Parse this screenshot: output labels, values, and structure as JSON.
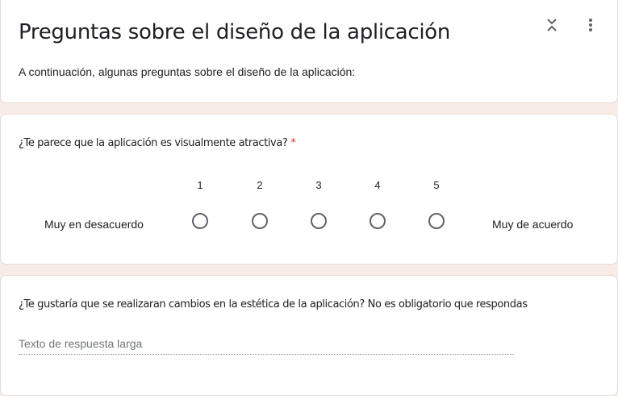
{
  "header": {
    "title": "Preguntas sobre el diseño de la aplicación",
    "description": "A continuación, algunas preguntas sobre el diseño de la aplicación:",
    "collapse_icon": "collapse-icon",
    "more_icon": "more-vert-icon"
  },
  "question1": {
    "title": "¿Te parece que la aplicación es visualmente atractiva?",
    "required_mark": "*",
    "scale": [
      "1",
      "2",
      "3",
      "4",
      "5"
    ],
    "low_label": "Muy en desacuerdo",
    "high_label": "Muy de acuerdo"
  },
  "question2": {
    "title": "¿Te gustaría que se realizaran cambios en la estética de la aplicación? No es obligatorio que respondas",
    "placeholder": "Texto de respuesta larga"
  },
  "colors": {
    "background": "#f8ece6",
    "required": "#d93025",
    "radio_border": "#5f6368"
  }
}
